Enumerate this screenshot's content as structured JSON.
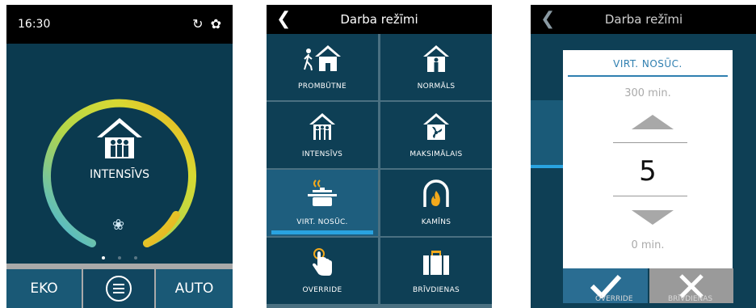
{
  "screen1": {
    "time": "16:30",
    "status_icons": [
      "refresh-icon",
      "fan-icon"
    ],
    "mode_label": "INTENSĪVS",
    "page_dots": 3,
    "active_dot": 0,
    "bottom": {
      "left": "EKO",
      "right": "AUTO"
    },
    "colors": {
      "ring_start": "#3fb5e6",
      "ring_mid": "#c5d93a",
      "ring_end": "#f2a91c",
      "bg": "#0b3a4f"
    }
  },
  "screen2": {
    "title": "Darba režīmi",
    "tiles": [
      {
        "label": "PROMBŪTNE",
        "icon": "away-icon"
      },
      {
        "label": "NORMĀLS",
        "icon": "home-person-icon"
      },
      {
        "label": "INTENSĪVS",
        "icon": "home-family-icon"
      },
      {
        "label": "MAKSIMĀLAIS",
        "icon": "home-fan-icon"
      },
      {
        "label": "VIRT. NOSŪC.",
        "icon": "cooking-pot-icon",
        "selected": true
      },
      {
        "label": "KAMĪNS",
        "icon": "fireplace-icon"
      },
      {
        "label": "OVERRIDE",
        "icon": "hand-pointer-icon"
      },
      {
        "label": "BRĪVDIENAS",
        "icon": "suitcase-icon"
      }
    ]
  },
  "screen3": {
    "title": "Darba režīmi",
    "dialog_title": "VIRT. NOSŪC.",
    "max_label": "300 min.",
    "value": "5",
    "min_label": "0 min.",
    "under_left": "OVERRIDE",
    "under_right": "BRĪVDIENAS"
  }
}
